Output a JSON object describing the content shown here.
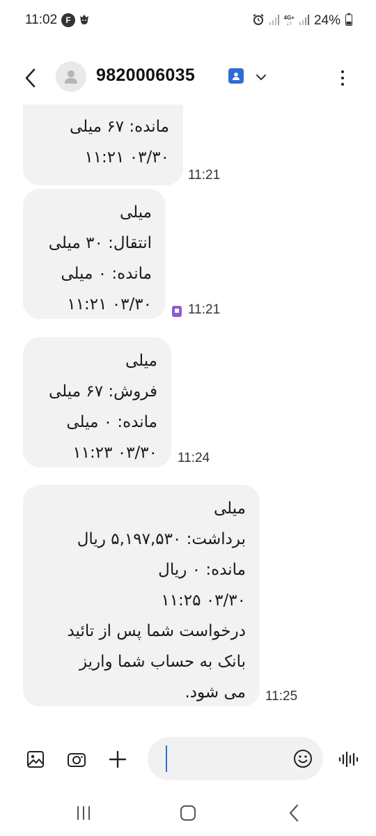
{
  "status_bar": {
    "time": "11:02",
    "badge": "F",
    "network": "4G+",
    "battery": "24%"
  },
  "header": {
    "contact": "9820006035"
  },
  "messages": [
    {
      "lines": [
        "مانده: ۶۷ میلی",
        "۰۳/۳۰ ۱۱:۲۱"
      ],
      "time": "11:21"
    },
    {
      "lines": [
        "میلی",
        "انتقال: ۳۰ میلی",
        "مانده: ۰ میلی",
        "۰۳/۳۰ ۱۱:۲۱"
      ],
      "time": "11:21"
    },
    {
      "lines": [
        "میلی",
        "فروش: ۶۷ میلی",
        "مانده: ۰ میلی",
        "۰۳/۳۰ ۱۱:۲۳"
      ],
      "time": "11:24"
    },
    {
      "lines": [
        "میلی",
        "برداشت: ۵,۱۹۷,۵۳۰ ریال",
        "مانده: ۰ ریال",
        "۰۳/۳۰ ۱۱:۲۵",
        "درخواست شما پس از تائید",
        "بانک به حساب شما واریز",
        "می شود."
      ],
      "time": "11:25"
    }
  ],
  "input": {
    "placeholder": ""
  },
  "icons": {
    "back": "back-arrow-icon",
    "avatar": "person-icon",
    "contact": "contact-card-icon",
    "expand": "chevron-down-icon",
    "more": "more-vertical-icon",
    "gallery": "image-icon",
    "camera": "camera-icon",
    "add": "plus-icon",
    "emoji": "emoji-icon",
    "voice": "voice-wave-icon",
    "sim": "sim-icon"
  },
  "colors": {
    "bubble": "#f2f2f2",
    "accent": "#2f6cd8",
    "sim": "#8e5bd6"
  }
}
